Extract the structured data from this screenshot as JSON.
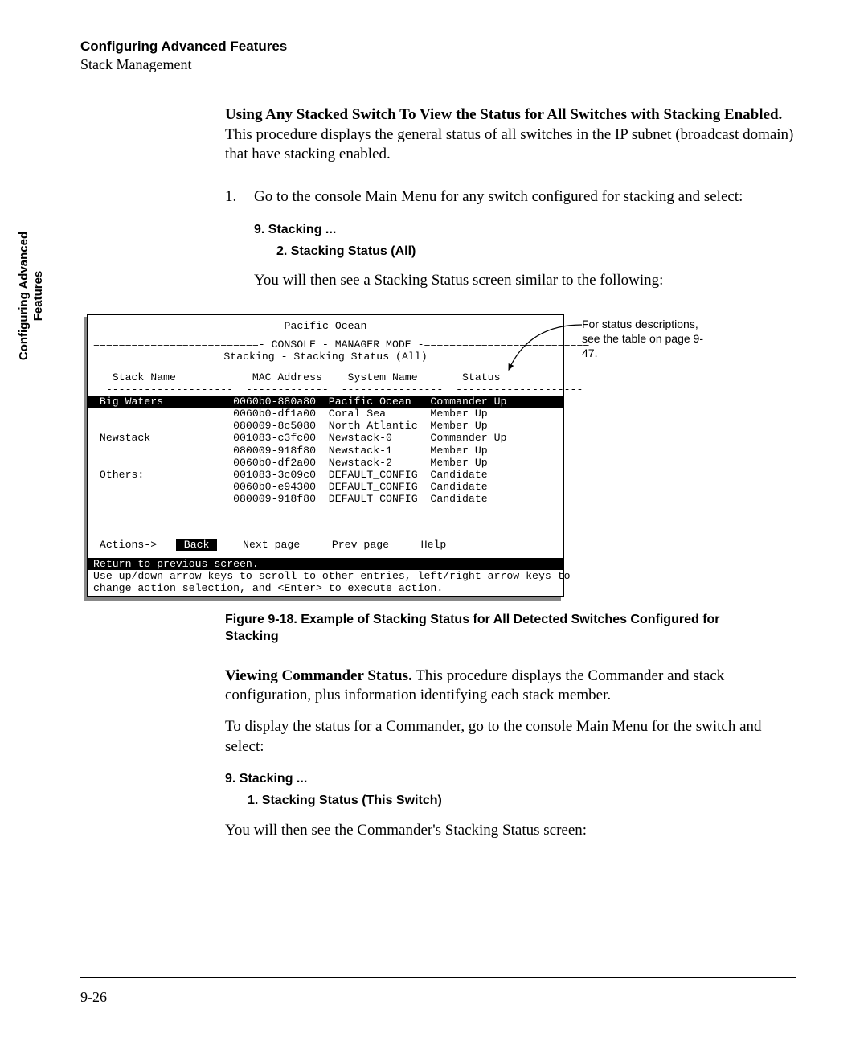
{
  "header": {
    "title": "Configuring Advanced Features",
    "subtitle": "Stack Management"
  },
  "side_tab": {
    "line1": "Configuring Advanced",
    "line2": "Features"
  },
  "intro": {
    "bold_lead": "Using Any Stacked Switch To View the Status for All Switches with Stacking Enabled.",
    "rest": " This procedure displays the general status of all switches in the IP subnet (broadcast domain) that have stacking enabled."
  },
  "step": {
    "num": "1.",
    "text": "Go to the console Main Menu for any switch configured for stacking and select:",
    "menu1": "9. Stacking ...",
    "menu2": "2. Stacking Status (All)",
    "followup": "You will then see a Stacking Status screen similar to the following:"
  },
  "terminal": {
    "title": "Pacific Ocean",
    "mode_line_left": "==========================",
    "mode_line_mid": "- CONSOLE - MANAGER MODE -",
    "mode_line_right": "==========================",
    "subtitle": "Stacking - Stacking Status (All)",
    "headers": {
      "stack": "Stack Name",
      "mac": "MAC Address",
      "sys": "System Name",
      "status": "Status"
    },
    "rows": [
      {
        "stack": "Big Waters",
        "mac": "0060b0-880a80",
        "sys": "Pacific Ocean",
        "status": "Commander Up",
        "hl": true
      },
      {
        "stack": "",
        "mac": "0060b0-df1a00",
        "sys": "Coral Sea",
        "status": "Member Up",
        "hl": false
      },
      {
        "stack": "",
        "mac": "080009-8c5080",
        "sys": "North Atlantic",
        "status": "Member Up",
        "hl": false
      },
      {
        "stack": "Newstack",
        "mac": "001083-c3fc00",
        "sys": "Newstack-0",
        "status": "Commander Up",
        "hl": false
      },
      {
        "stack": "",
        "mac": "080009-918f80",
        "sys": "Newstack-1",
        "status": "Member Up",
        "hl": false
      },
      {
        "stack": "",
        "mac": "0060b0-df2a00",
        "sys": "Newstack-2",
        "status": "Member Up",
        "hl": false
      },
      {
        "stack": "Others:",
        "mac": "001083-3c09c0",
        "sys": "DEFAULT_CONFIG",
        "status": "Candidate",
        "hl": false
      },
      {
        "stack": "",
        "mac": "0060b0-e94300",
        "sys": "DEFAULT_CONFIG",
        "status": "Candidate",
        "hl": false
      },
      {
        "stack": "",
        "mac": "080009-918f80",
        "sys": "DEFAULT_CONFIG",
        "status": "Candidate",
        "hl": false
      }
    ],
    "actions": {
      "label": " Actions->",
      "back": "Back",
      "next": "Next page",
      "prev": "Prev page",
      "help": "Help"
    },
    "return_line": "Return to previous screen.",
    "help1": "Use up/down arrow keys to scroll to other entries, left/right arrow keys to",
    "help2": "change action selection, and <Enter> to execute action."
  },
  "annotation": {
    "text": "For status descriptions, see the table on page 9-47."
  },
  "figure_caption": "Figure 9-18.  Example of Stacking Status for All Detected Switches Configured for Stacking",
  "section2": {
    "bold_lead": "Viewing Commander Status.",
    "rest": " This procedure displays the Commander and stack configuration, plus information identifying each stack member.",
    "para2": "To display the status for a Commander, go to the console Main Menu for the switch and select:",
    "menu1": "9. Stacking ...",
    "menu2": "1. Stacking Status (This Switch)",
    "followup": "You will then see the Commander's Stacking Status screen:"
  },
  "page_num": "9-26"
}
